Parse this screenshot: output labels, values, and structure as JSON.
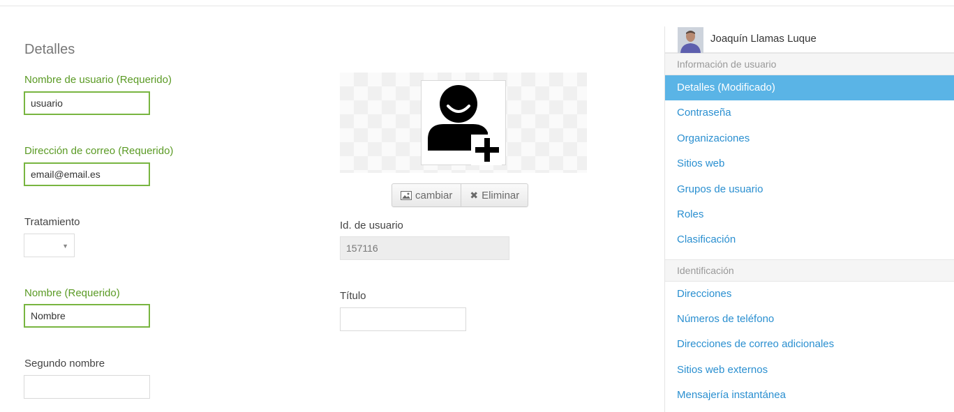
{
  "form": {
    "section_title": "Detalles",
    "username": {
      "label": "Nombre de usuario (Requerido)",
      "value": "usuario"
    },
    "email": {
      "label": "Dirección de correo (Requerido)",
      "value": "email@email.es"
    },
    "treatment": {
      "label": "Tratamiento",
      "value": ""
    },
    "first_name": {
      "label": "Nombre (Requerido)",
      "value": "Nombre"
    },
    "middle_name": {
      "label": "Segundo nombre",
      "value": ""
    },
    "user_id": {
      "label": "Id. de usuario",
      "value": "157116"
    },
    "title": {
      "label": "Título",
      "value": ""
    }
  },
  "avatar": {
    "icon": "user-add-icon",
    "change_label": "cambiar",
    "delete_label": "Eliminar"
  },
  "sidebar": {
    "user_name": "Joaquín Llamas Luque",
    "groups": [
      {
        "title": "Información de usuario",
        "items": [
          {
            "label": "Detalles (Modificado)",
            "active": true
          },
          {
            "label": "Contraseña"
          },
          {
            "label": "Organizaciones"
          },
          {
            "label": "Sitios web"
          },
          {
            "label": "Grupos de usuario"
          },
          {
            "label": "Roles"
          },
          {
            "label": "Clasificación"
          }
        ]
      },
      {
        "title": "Identificación",
        "items": [
          {
            "label": "Direcciones"
          },
          {
            "label": "Números de teléfono"
          },
          {
            "label": "Direcciones de correo adicionales"
          },
          {
            "label": "Sitios web externos"
          },
          {
            "label": "Mensajería instantánea"
          }
        ]
      }
    ]
  },
  "colors": {
    "required": "#5a9a24",
    "required_border": "#78b540",
    "link": "#2a8fd0",
    "active_bg": "#5ab4e6"
  }
}
